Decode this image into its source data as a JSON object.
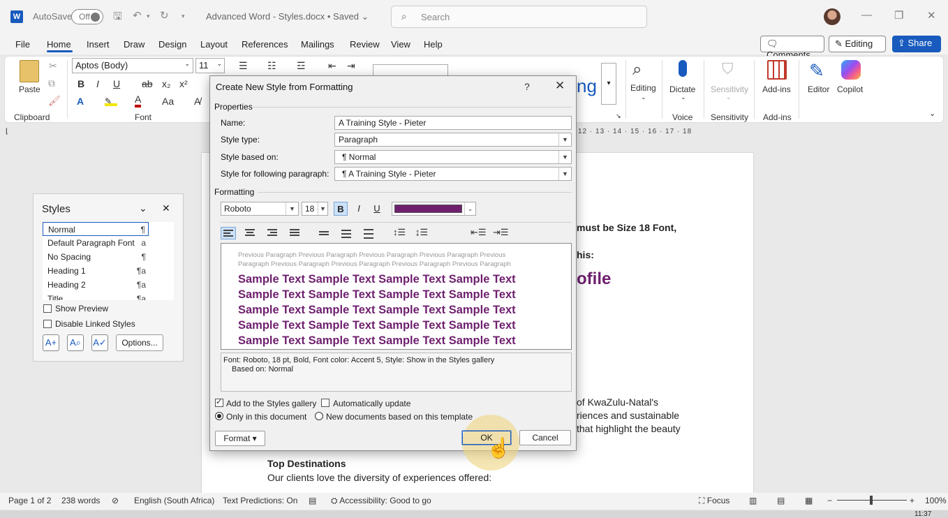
{
  "app": {
    "autosave_label": "AutoSave",
    "autosave_state": "Off",
    "doc_title": "Advanced Word - Styles.docx • Saved",
    "search_placeholder": "Search"
  },
  "menu": {
    "items": [
      "File",
      "Home",
      "Insert",
      "Draw",
      "Design",
      "Layout",
      "References",
      "Mailings",
      "Review",
      "View",
      "Help"
    ],
    "comments": "Comments",
    "editing": "Editing",
    "share": "Share"
  },
  "ribbon": {
    "paste": "Paste",
    "clipboard": "Clipboard",
    "font_name": "Aptos (Body)",
    "font_size": "11",
    "font_group": "Font",
    "editing": "Editing",
    "dictate": "Dictate",
    "voice": "Voice",
    "sensitivity": "Sensitivity",
    "sensitivity_group": "Sensitivity",
    "addins": "Add-ins",
    "addins_group": "Add-ins",
    "editor": "Editor",
    "copilot": "Copilot",
    "gallery_partial": "ng"
  },
  "ruler": {
    "numbers": "12 · 13 · 14 · 15 · 16 · 17 · 18"
  },
  "document": {
    "line1": "must be Size 18 Font,",
    "line2": "his:",
    "line3": "ofile",
    "para1": "of KwaZulu-Natal's",
    "para2": "riences and sustainable",
    "para3": "that highlight the beauty",
    "heading": "Top Destinations",
    "body": "Our clients love the diversity of experiences offered:"
  },
  "styles_pane": {
    "title": "Styles",
    "items": [
      {
        "name": "Normal",
        "mark": "¶"
      },
      {
        "name": "Default Paragraph Font",
        "mark": "a"
      },
      {
        "name": "No Spacing",
        "mark": "¶"
      },
      {
        "name": "Heading 1",
        "mark": "¶a"
      },
      {
        "name": "Heading 2",
        "mark": "¶a"
      },
      {
        "name": "Title",
        "mark": "¶a"
      }
    ],
    "show_preview": "Show Preview",
    "disable_linked": "Disable Linked Styles",
    "options": "Options..."
  },
  "dialog": {
    "title": "Create New Style from Formatting",
    "help": "?",
    "properties": "Properties",
    "name_label": "Name:",
    "name_value": "A Training Style - Pieter",
    "type_label": "Style type:",
    "type_value": "Paragraph",
    "based_label": "Style based on:",
    "based_value": "¶  Normal",
    "following_label": "Style for following paragraph:",
    "following_value": "¶  A Training Style - Pieter",
    "formatting": "Formatting",
    "font": "Roboto",
    "size": "18",
    "bold": "B",
    "italic": "I",
    "underline": "U",
    "font_color": "#6e1f6e",
    "preview_prev": "Previous Paragraph Previous Paragraph Previous Paragraph Previous Paragraph Previous Paragraph Previous Paragraph Previous Paragraph Previous Paragraph Previous Paragraph",
    "sample_lines": [
      "Sample Text Sample Text Sample Text Sample Text",
      "Sample Text Sample Text Sample Text Sample Text",
      "Sample Text Sample Text Sample Text Sample Text",
      "Sample Text Sample Text Sample Text Sample Text",
      "Sample Text Sample Text Sample Text Sample Text"
    ],
    "desc_line1": "Font: Roboto, 18 pt, Bold, Font color: Accent 5, Style: Show in the Styles gallery",
    "desc_line2": "Based on: Normal",
    "add_gallery": "Add to the Styles gallery",
    "auto_update": "Automatically update",
    "only_doc": "Only in this document",
    "new_docs": "New documents based on this template",
    "format_btn": "Format ▾",
    "ok": "OK",
    "cancel": "Cancel"
  },
  "status": {
    "page": "Page 1 of 2",
    "words": "238 words",
    "language": "English (South Africa)",
    "predictions": "Text Predictions: On",
    "accessibility": "Accessibility: Good to go",
    "focus": "Focus",
    "zoom": "100%",
    "time": "11:37"
  }
}
